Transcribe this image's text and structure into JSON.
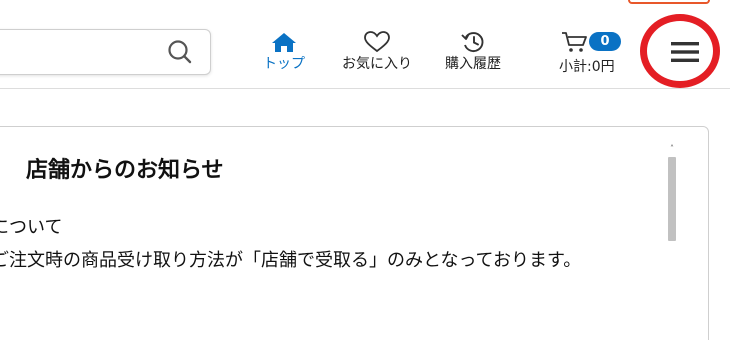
{
  "search": {
    "value": "",
    "placeholder": ""
  },
  "nav": {
    "top_label": "トップ",
    "favorites_label": "お気に入り",
    "history_label": "購入履歴"
  },
  "cart": {
    "count": "0",
    "subtotal": "小計:0円"
  },
  "notice": {
    "title": "店舗からのお知らせ",
    "lines": [
      "について",
      "ご注文時の商品受け取り方法が「店舗で受取る」のみとなっております。"
    ]
  },
  "colors": {
    "accent_blue": "#0a72c4",
    "highlight_red": "#e41e24",
    "corner_button_orange": "#e8572a"
  },
  "icons": [
    "search-icon",
    "home-icon",
    "heart-icon",
    "history-icon",
    "cart-icon",
    "hamburger-menu-icon"
  ]
}
